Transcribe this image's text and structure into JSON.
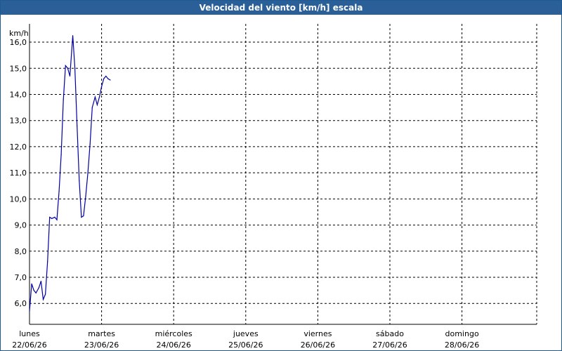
{
  "title": "Velocidad del viento [km/h] escala",
  "chart_data": {
    "type": "line",
    "title": "Velocidad del viento [km/h] escala",
    "ylabel": "km/h",
    "xlabel": "",
    "ylim": [
      5.2,
      16.7
    ],
    "xlim": [
      0,
      7
    ],
    "grid": true,
    "line_color": "#0000a0",
    "yticks": [
      {
        "value": 6,
        "label": "6,0"
      },
      {
        "value": 7,
        "label": "7,0"
      },
      {
        "value": 8,
        "label": "8,0"
      },
      {
        "value": 9,
        "label": "9,0"
      },
      {
        "value": 10,
        "label": "10,0"
      },
      {
        "value": 11,
        "label": "11,0"
      },
      {
        "value": 12,
        "label": "12,0"
      },
      {
        "value": 13,
        "label": "13,0"
      },
      {
        "value": 14,
        "label": "14,0"
      },
      {
        "value": 15,
        "label": "15,0"
      },
      {
        "value": 16,
        "label": "16,0"
      }
    ],
    "xticks": [
      {
        "value": 0,
        "day": "lunes",
        "date": "22/06/26"
      },
      {
        "value": 1,
        "day": "martes",
        "date": "23/06/26"
      },
      {
        "value": 2,
        "day": "miércoles",
        "date": "24/06/26"
      },
      {
        "value": 3,
        "day": "jueves",
        "date": "25/06/26"
      },
      {
        "value": 4,
        "day": "viernes",
        "date": "26/06/26"
      },
      {
        "value": 5,
        "day": "sábado",
        "date": "27/06/26"
      },
      {
        "value": 6,
        "day": "domingo",
        "date": "28/06/26"
      }
    ],
    "series": [
      {
        "x": [
          0.0,
          0.03,
          0.06,
          0.09,
          0.13,
          0.16,
          0.19,
          0.22,
          0.25,
          0.28,
          0.31,
          0.35,
          0.38,
          0.41,
          0.44,
          0.47,
          0.5,
          0.53,
          0.56,
          0.6,
          0.63,
          0.66,
          0.69,
          0.72,
          0.75,
          0.78,
          0.81,
          0.84,
          0.87,
          0.91,
          0.94,
          0.97,
          1.0,
          1.03,
          1.06,
          1.09,
          1.12
        ],
        "y": [
          5.7,
          6.75,
          6.5,
          6.4,
          6.6,
          6.85,
          6.15,
          6.35,
          7.6,
          9.3,
          9.25,
          9.3,
          9.2,
          10.3,
          11.7,
          13.8,
          15.1,
          15.0,
          14.7,
          16.25,
          15.0,
          12.8,
          10.7,
          9.3,
          9.35,
          10.1,
          11.0,
          12.1,
          13.5,
          13.9,
          13.6,
          13.9,
          14.3,
          14.6,
          14.7,
          14.6,
          14.55
        ]
      }
    ]
  }
}
